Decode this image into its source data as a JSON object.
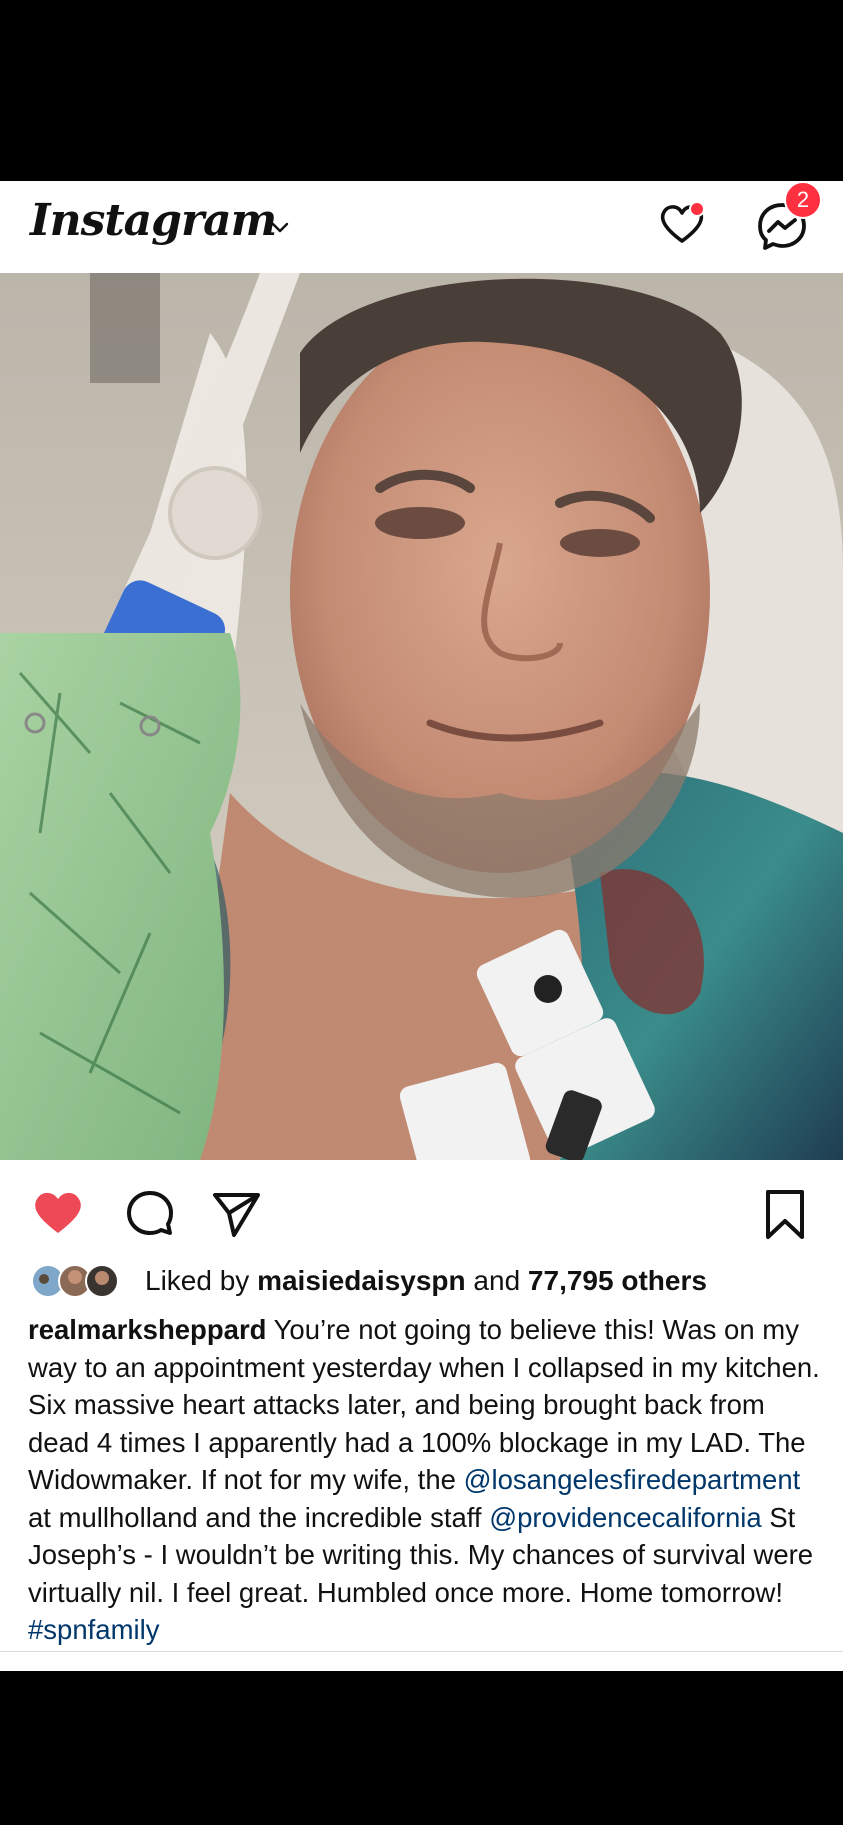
{
  "header": {
    "logo_text": "Instagram",
    "notification_badge": "2",
    "icons": [
      "chevron-down-icon",
      "heart-icon",
      "messenger-icon"
    ],
    "accent_color": "#ff3040"
  },
  "post": {
    "photo_alt": "selfie",
    "liked_by_prefix": "Liked by ",
    "liked_by_user": "maisiedaisyspn",
    "liked_by_mid": " and ",
    "liked_by_count": "77,795 others",
    "username": "realmarksheppard",
    "caption_1": " You’re not going to believe this!  Was on my way to an appointment yesterday when I collapsed in my kitchen. Six massive heart attacks later, and being brought back from dead 4 times I apparently had a 100% blockage in my LAD. The Widowmaker. If not for my wife, the ",
    "mention_1": "@losangelesfiredepartment",
    "caption_2": " at mullholland and the incredible staff ",
    "mention_2": "@providencecalifornia",
    "caption_3": " St Joseph’s -  I wouldn’t be  writing this. My chances of survival were virtually nil. I feel great. Humbled once  more. Home tomorrow! ",
    "hashtag": "#spnfamily",
    "liked_color": "#ed4956",
    "link_color": "#00376b"
  }
}
